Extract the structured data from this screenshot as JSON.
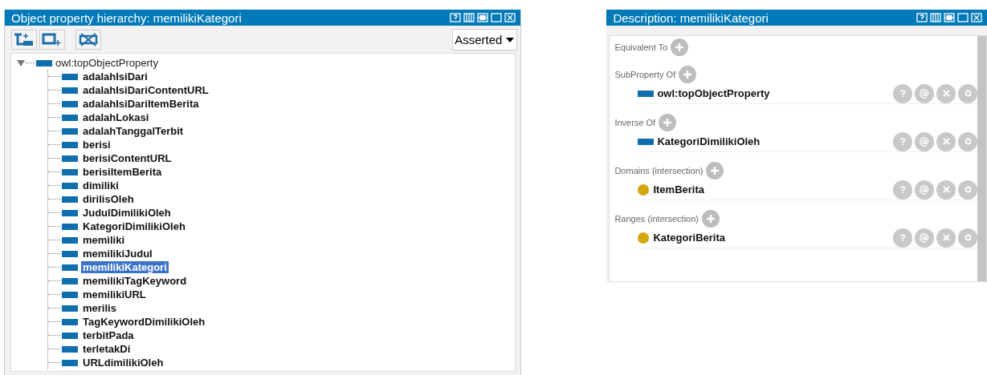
{
  "hierarchy": {
    "title": "Object property hierarchy: memilikiKategori",
    "mode": "Asserted",
    "root": {
      "label": "owl:topObjectProperty",
      "expanded": true,
      "children": [
        {
          "label": "adalahIsiDari",
          "selected": false
        },
        {
          "label": "adalahIsiDariContentURL",
          "selected": false
        },
        {
          "label": "adalahIsiDariItemBerita",
          "selected": false
        },
        {
          "label": "adalahLokasi",
          "selected": false
        },
        {
          "label": "adalahTanggalTerbit",
          "selected": false
        },
        {
          "label": "berisi",
          "selected": false
        },
        {
          "label": "berisiContentURL",
          "selected": false
        },
        {
          "label": "berisiItemBerita",
          "selected": false
        },
        {
          "label": "dimiliki",
          "selected": false
        },
        {
          "label": "dirilisOleh",
          "selected": false
        },
        {
          "label": "JudulDimilikiOleh",
          "selected": false
        },
        {
          "label": "KategoriDimilikiOleh",
          "selected": false
        },
        {
          "label": "memiliki",
          "selected": false
        },
        {
          "label": "memilikiJudul",
          "selected": false
        },
        {
          "label": "memilikiKategori",
          "selected": true
        },
        {
          "label": "memilikiTagKeyword",
          "selected": false
        },
        {
          "label": "memilikiURL",
          "selected": false
        },
        {
          "label": "merilis",
          "selected": false
        },
        {
          "label": "TagKeywordDimilikiOleh",
          "selected": false
        },
        {
          "label": "terbitPada",
          "selected": false
        },
        {
          "label": "terletakDi",
          "selected": false
        },
        {
          "label": "URLdimilikiOleh",
          "selected": false
        }
      ]
    }
  },
  "description": {
    "title": "Description: memilikiKategori",
    "sections": [
      {
        "label": "Equivalent To"
      },
      {
        "label": "SubProperty Of",
        "entries": [
          {
            "label": "owl:topObjectProperty",
            "kind": "property"
          }
        ]
      },
      {
        "label": "Inverse Of",
        "entries": [
          {
            "label": "KategoriDimilikiOleh",
            "kind": "property"
          }
        ]
      },
      {
        "label": "Domains (intersection)",
        "entries": [
          {
            "label": "ItemBerita",
            "kind": "class"
          }
        ]
      },
      {
        "label": "Ranges (intersection)",
        "entries": [
          {
            "label": "KategoriBerita",
            "kind": "class"
          }
        ]
      }
    ]
  }
}
